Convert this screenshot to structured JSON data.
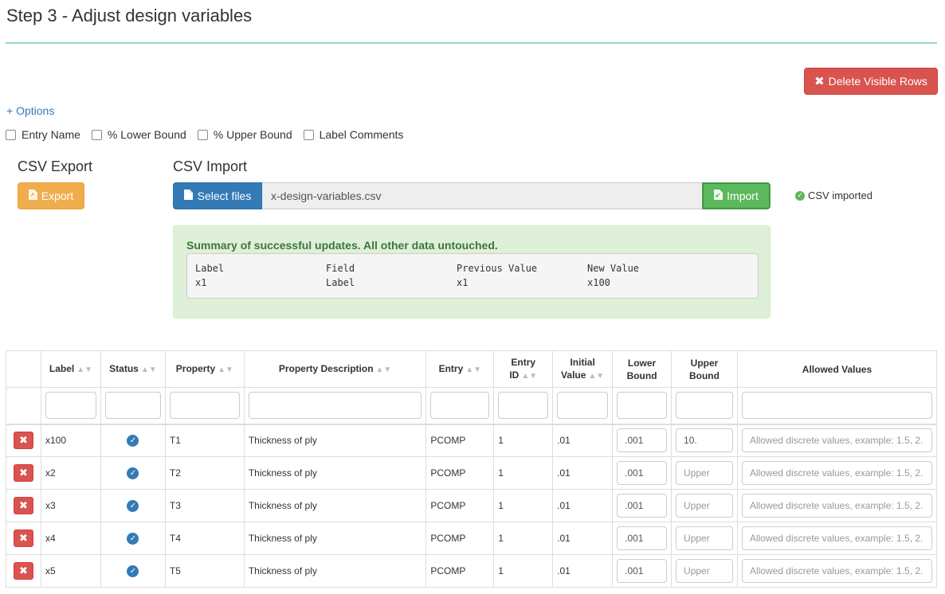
{
  "page": {
    "title": "Step 3 - Adjust design variables"
  },
  "toolbar": {
    "delete_label": "Delete Visible Rows",
    "delete_icon": "close-icon"
  },
  "options": {
    "link_label": "+ Options",
    "checkboxes": [
      {
        "label": "Entry Name",
        "checked": false
      },
      {
        "label": "% Lower Bound",
        "checked": false
      },
      {
        "label": "% Upper Bound",
        "checked": false
      },
      {
        "label": "Label Comments",
        "checked": false
      }
    ]
  },
  "csv_export": {
    "heading": "CSV Export",
    "button_label": "Export",
    "button_icon": "file-export-icon"
  },
  "csv_import": {
    "heading": "CSV Import",
    "select_label": "Select files",
    "file_name": "x-design-variables.csv",
    "import_label": "Import",
    "status": "CSV imported",
    "status_icon": "check-circle-icon"
  },
  "summary": {
    "title": "Summary of successful updates. All other data untouched.",
    "columns": [
      "Label",
      "Field",
      "Previous Value",
      "New Value"
    ],
    "rows": [
      [
        "x1",
        "Label",
        "x1",
        "x100"
      ]
    ]
  },
  "table": {
    "headers": {
      "label": "Label",
      "status": "Status",
      "property": "Property",
      "description": "Property Description",
      "entry": "Entry",
      "entry_id_1": "Entry",
      "entry_id_2": "ID",
      "initial_1": "Initial",
      "initial_2": "Value",
      "lower_1": "Lower",
      "lower_2": "Bound",
      "upper_1": "Upper",
      "upper_2": "Bound",
      "allowed": "Allowed Values"
    },
    "upper_placeholder": "Upper",
    "allowed_placeholder": "Allowed discrete values, example: 1.5, 2.",
    "rows": [
      {
        "label": "x100",
        "property": "T1",
        "description": "Thickness of ply",
        "entry": "PCOMP",
        "entry_id": "1",
        "initial": ".01",
        "lower": ".001",
        "upper": "10.",
        "allowed": ""
      },
      {
        "label": "x2",
        "property": "T2",
        "description": "Thickness of ply",
        "entry": "PCOMP",
        "entry_id": "1",
        "initial": ".01",
        "lower": ".001",
        "upper": "",
        "allowed": ""
      },
      {
        "label": "x3",
        "property": "T3",
        "description": "Thickness of ply",
        "entry": "PCOMP",
        "entry_id": "1",
        "initial": ".01",
        "lower": ".001",
        "upper": "",
        "allowed": ""
      },
      {
        "label": "x4",
        "property": "T4",
        "description": "Thickness of ply",
        "entry": "PCOMP",
        "entry_id": "1",
        "initial": ".01",
        "lower": ".001",
        "upper": "",
        "allowed": ""
      },
      {
        "label": "x5",
        "property": "T5",
        "description": "Thickness of ply",
        "entry": "PCOMP",
        "entry_id": "1",
        "initial": ".01",
        "lower": ".001",
        "upper": "",
        "allowed": ""
      }
    ]
  },
  "colors": {
    "primary": "#337ab7",
    "danger": "#d9534f",
    "warning": "#f0ad4e",
    "success": "#5cb85c",
    "accent_rule": "#93d7c3"
  }
}
